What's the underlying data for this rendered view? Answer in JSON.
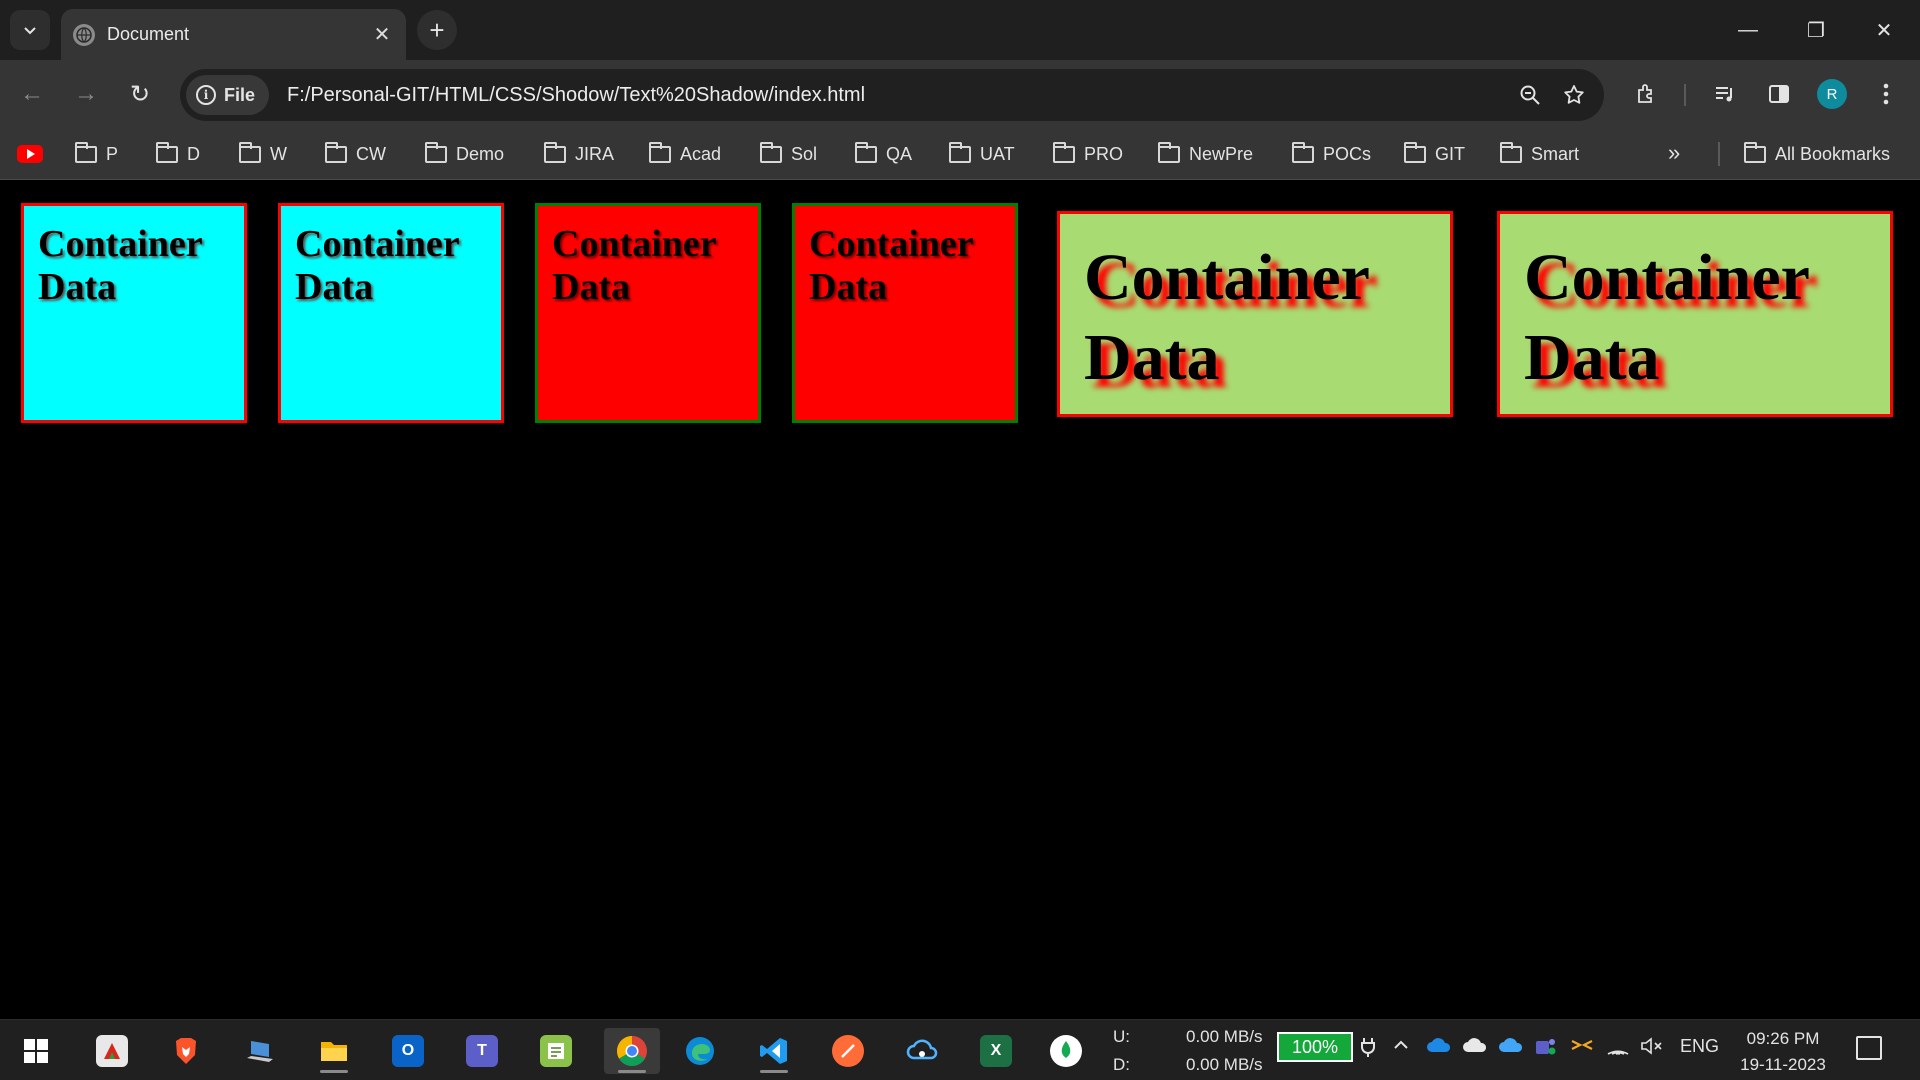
{
  "tab": {
    "title": "Document",
    "close": "✕",
    "new_tab": "+"
  },
  "window": {
    "minimize": "—",
    "restore": "❐",
    "close": "✕"
  },
  "toolbar": {
    "back": "←",
    "forward": "→",
    "reload": "↻",
    "site_chip": "File",
    "url": "F:/Personal-GIT/HTML/CSS/Shodow/Text%20Shadow/index.html",
    "avatar_initial": "R"
  },
  "bookmarks": {
    "items": [
      "P",
      "D",
      "W",
      "CW",
      "Demo",
      "JIRA",
      "Acad",
      "Sol",
      "QA",
      "UAT",
      "PRO",
      "NewPre",
      "POCs",
      "GIT",
      "Smart"
    ],
    "overflow": "»",
    "all": "All Bookmarks"
  },
  "page": {
    "boxes": [
      {
        "text": "Container Data",
        "style": "cyan"
      },
      {
        "text": "Container Data",
        "style": "cyan"
      },
      {
        "text": "Container Data",
        "style": "red"
      },
      {
        "text": "Container Data",
        "style": "red"
      },
      {
        "text": "Container Data",
        "style": "green-large"
      },
      {
        "text": "Container Data",
        "style": "green-large"
      }
    ]
  },
  "taskbar": {
    "upload_label": "U:",
    "download_label": "D:",
    "upload_speed": "0.00 MB/s",
    "download_speed": "0.00 MB/s",
    "battery": "100%",
    "language": "ENG",
    "time": "09:26 PM",
    "date": "19-11-2023"
  },
  "colors": {
    "cyan_box": "#00ffff",
    "red_box": "#ff0000",
    "green_box": "#a8dc72",
    "box_border_red": "#ff0000",
    "box_border_green": "#008000"
  }
}
